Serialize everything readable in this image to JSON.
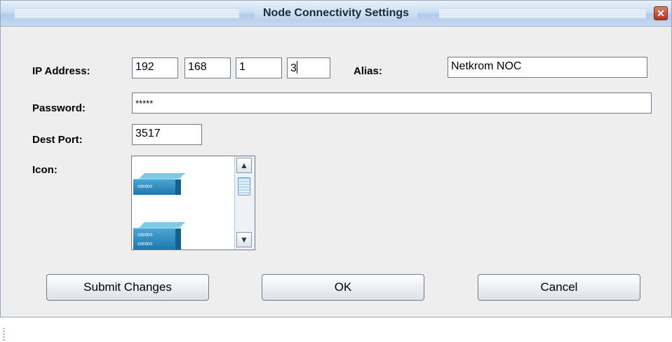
{
  "window": {
    "title": "Node Connectivity Settings",
    "close_icon": "close-icon"
  },
  "form": {
    "ip_label": "IP Address:",
    "ip_octets": [
      "192",
      "168",
      "1",
      "3"
    ],
    "alias_label": "Alias:",
    "alias_value": "Netkrom NOC",
    "password_label": "Password:",
    "password_value": "*****",
    "port_label": "Dest Port:",
    "port_value": "3517",
    "icon_label": "Icon:"
  },
  "icon_list": {
    "items": [
      "network-switch-icon",
      "network-switch-stack-icon"
    ],
    "scroll_up": "▲",
    "scroll_down": "▼"
  },
  "buttons": {
    "submit": "Submit Changes",
    "ok": "OK",
    "cancel": "Cancel"
  },
  "colors": {
    "titlebar": "#c9dcf2",
    "close": "#c0392b",
    "device": "#2b8fc4"
  }
}
